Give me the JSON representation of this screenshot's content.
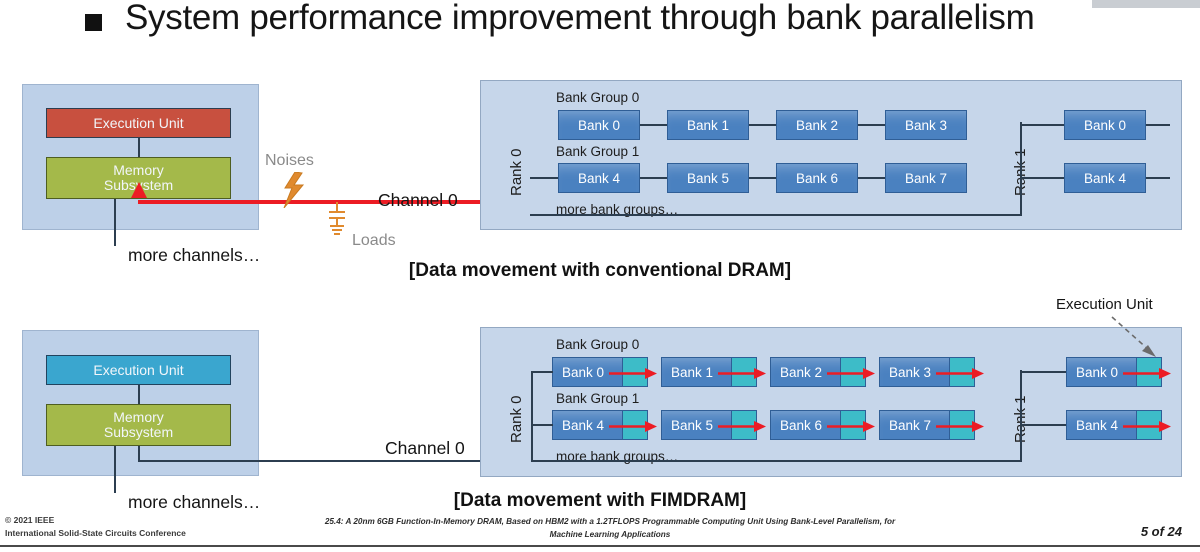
{
  "slide": {
    "title": "System performance improvement through bank parallelism",
    "bullet_icon": "square-bullet-icon"
  },
  "conventional": {
    "caption": "[Data movement with conventional DRAM]",
    "host": {
      "execution_unit": "Execution Unit",
      "memory_subsystem": "Memory\nSubsystem",
      "memory_subsystem_line1": "Memory",
      "memory_subsystem_line2": "Subsystem",
      "more_channels": "more channels…"
    },
    "channel_label": "Channel 0",
    "noises_label": "Noises",
    "loads_label": "Loads",
    "dram": {
      "rank0_label": "Rank 0",
      "rank1_label": "Rank 1",
      "bank_group_0": "Bank Group 0",
      "bank_group_1": "Bank Group 1",
      "more_bank_groups": "more bank groups…",
      "rank0_group0_banks": [
        "Bank 0",
        "Bank 1",
        "Bank 2",
        "Bank 3"
      ],
      "rank0_group1_banks": [
        "Bank 4",
        "Bank 5",
        "Bank 6",
        "Bank 7"
      ],
      "rank1_group0_banks": [
        "Bank 0"
      ],
      "rank1_group1_banks": [
        "Bank 4"
      ]
    }
  },
  "fimdram": {
    "caption": "[Data movement with FIMDRAM]",
    "host": {
      "execution_unit": "Execution Unit",
      "memory_subsystem_line1": "Memory",
      "memory_subsystem_line2": "Subsystem",
      "more_channels": "more channels…"
    },
    "channel_label": "Channel 0",
    "callout_label": "Execution Unit",
    "dram": {
      "rank0_label": "Rank 0",
      "rank1_label": "Rank 1",
      "bank_group_0": "Bank Group 0",
      "bank_group_1": "Bank Group 1",
      "more_bank_groups": "more bank groups…",
      "rank0_group0_banks": [
        "Bank 0",
        "Bank 1",
        "Bank 2",
        "Bank 3"
      ],
      "rank0_group1_banks": [
        "Bank 4",
        "Bank 5",
        "Bank 6",
        "Bank 7"
      ],
      "rank1_group0_banks": [
        "Bank 0"
      ],
      "rank1_group1_banks": [
        "Bank 4"
      ]
    }
  },
  "footer": {
    "copyright_line1": "© 2021 IEEE",
    "copyright_line2": "International Solid-State Circuits Conference",
    "paper_title_line1": "25.4: A 20nm 6GB Function-In-Memory DRAM, Based on HBM2 with a 1.2TFLOPS Programmable Computing Unit Using Bank-Level Parallelism, for",
    "paper_title_line2": "Machine Learning Applications",
    "page_indicator": "5 of 24"
  },
  "colors": {
    "execution_unit_red": "#c8503f",
    "execution_unit_teal": "#3aa6cf",
    "memory_subsystem_green": "#a4b94a",
    "bank_blue": "#4a81c0",
    "pim_unit_teal": "#3dbcc8",
    "host_panel_blue": "#bdd0e8",
    "dram_panel_blue": "#c6d6ea",
    "data_path_red": "#ec1c24",
    "noise_orange": "#e08a2e",
    "wire_navy": "#2c3e50"
  }
}
